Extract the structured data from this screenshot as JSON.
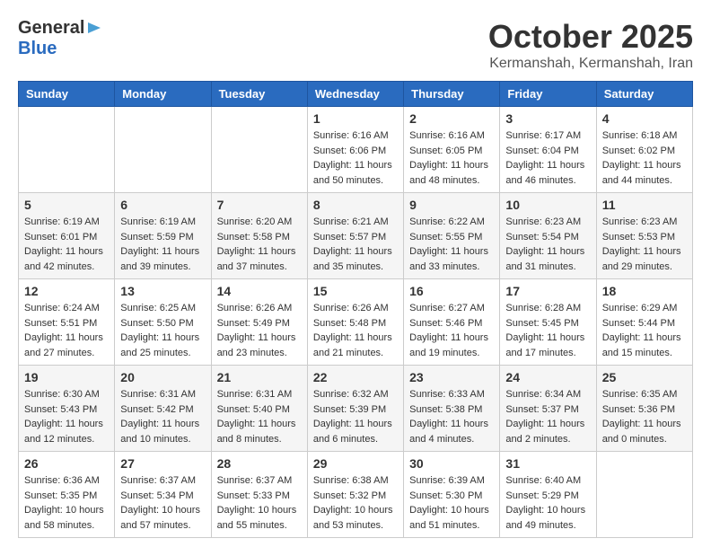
{
  "header": {
    "logo_general": "General",
    "logo_blue": "Blue",
    "title": "October 2025",
    "subtitle": "Kermanshah, Kermanshah, Iran"
  },
  "calendar": {
    "days_of_week": [
      "Sunday",
      "Monday",
      "Tuesday",
      "Wednesday",
      "Thursday",
      "Friday",
      "Saturday"
    ],
    "weeks": [
      [
        {
          "day": "",
          "info": ""
        },
        {
          "day": "",
          "info": ""
        },
        {
          "day": "",
          "info": ""
        },
        {
          "day": "1",
          "info": "Sunrise: 6:16 AM\nSunset: 6:06 PM\nDaylight: 11 hours\nand 50 minutes."
        },
        {
          "day": "2",
          "info": "Sunrise: 6:16 AM\nSunset: 6:05 PM\nDaylight: 11 hours\nand 48 minutes."
        },
        {
          "day": "3",
          "info": "Sunrise: 6:17 AM\nSunset: 6:04 PM\nDaylight: 11 hours\nand 46 minutes."
        },
        {
          "day": "4",
          "info": "Sunrise: 6:18 AM\nSunset: 6:02 PM\nDaylight: 11 hours\nand 44 minutes."
        }
      ],
      [
        {
          "day": "5",
          "info": "Sunrise: 6:19 AM\nSunset: 6:01 PM\nDaylight: 11 hours\nand 42 minutes."
        },
        {
          "day": "6",
          "info": "Sunrise: 6:19 AM\nSunset: 5:59 PM\nDaylight: 11 hours\nand 39 minutes."
        },
        {
          "day": "7",
          "info": "Sunrise: 6:20 AM\nSunset: 5:58 PM\nDaylight: 11 hours\nand 37 minutes."
        },
        {
          "day": "8",
          "info": "Sunrise: 6:21 AM\nSunset: 5:57 PM\nDaylight: 11 hours\nand 35 minutes."
        },
        {
          "day": "9",
          "info": "Sunrise: 6:22 AM\nSunset: 5:55 PM\nDaylight: 11 hours\nand 33 minutes."
        },
        {
          "day": "10",
          "info": "Sunrise: 6:23 AM\nSunset: 5:54 PM\nDaylight: 11 hours\nand 31 minutes."
        },
        {
          "day": "11",
          "info": "Sunrise: 6:23 AM\nSunset: 5:53 PM\nDaylight: 11 hours\nand 29 minutes."
        }
      ],
      [
        {
          "day": "12",
          "info": "Sunrise: 6:24 AM\nSunset: 5:51 PM\nDaylight: 11 hours\nand 27 minutes."
        },
        {
          "day": "13",
          "info": "Sunrise: 6:25 AM\nSunset: 5:50 PM\nDaylight: 11 hours\nand 25 minutes."
        },
        {
          "day": "14",
          "info": "Sunrise: 6:26 AM\nSunset: 5:49 PM\nDaylight: 11 hours\nand 23 minutes."
        },
        {
          "day": "15",
          "info": "Sunrise: 6:26 AM\nSunset: 5:48 PM\nDaylight: 11 hours\nand 21 minutes."
        },
        {
          "day": "16",
          "info": "Sunrise: 6:27 AM\nSunset: 5:46 PM\nDaylight: 11 hours\nand 19 minutes."
        },
        {
          "day": "17",
          "info": "Sunrise: 6:28 AM\nSunset: 5:45 PM\nDaylight: 11 hours\nand 17 minutes."
        },
        {
          "day": "18",
          "info": "Sunrise: 6:29 AM\nSunset: 5:44 PM\nDaylight: 11 hours\nand 15 minutes."
        }
      ],
      [
        {
          "day": "19",
          "info": "Sunrise: 6:30 AM\nSunset: 5:43 PM\nDaylight: 11 hours\nand 12 minutes."
        },
        {
          "day": "20",
          "info": "Sunrise: 6:31 AM\nSunset: 5:42 PM\nDaylight: 11 hours\nand 10 minutes."
        },
        {
          "day": "21",
          "info": "Sunrise: 6:31 AM\nSunset: 5:40 PM\nDaylight: 11 hours\nand 8 minutes."
        },
        {
          "day": "22",
          "info": "Sunrise: 6:32 AM\nSunset: 5:39 PM\nDaylight: 11 hours\nand 6 minutes."
        },
        {
          "day": "23",
          "info": "Sunrise: 6:33 AM\nSunset: 5:38 PM\nDaylight: 11 hours\nand 4 minutes."
        },
        {
          "day": "24",
          "info": "Sunrise: 6:34 AM\nSunset: 5:37 PM\nDaylight: 11 hours\nand 2 minutes."
        },
        {
          "day": "25",
          "info": "Sunrise: 6:35 AM\nSunset: 5:36 PM\nDaylight: 11 hours\nand 0 minutes."
        }
      ],
      [
        {
          "day": "26",
          "info": "Sunrise: 6:36 AM\nSunset: 5:35 PM\nDaylight: 10 hours\nand 58 minutes."
        },
        {
          "day": "27",
          "info": "Sunrise: 6:37 AM\nSunset: 5:34 PM\nDaylight: 10 hours\nand 57 minutes."
        },
        {
          "day": "28",
          "info": "Sunrise: 6:37 AM\nSunset: 5:33 PM\nDaylight: 10 hours\nand 55 minutes."
        },
        {
          "day": "29",
          "info": "Sunrise: 6:38 AM\nSunset: 5:32 PM\nDaylight: 10 hours\nand 53 minutes."
        },
        {
          "day": "30",
          "info": "Sunrise: 6:39 AM\nSunset: 5:30 PM\nDaylight: 10 hours\nand 51 minutes."
        },
        {
          "day": "31",
          "info": "Sunrise: 6:40 AM\nSunset: 5:29 PM\nDaylight: 10 hours\nand 49 minutes."
        },
        {
          "day": "",
          "info": ""
        }
      ]
    ]
  }
}
